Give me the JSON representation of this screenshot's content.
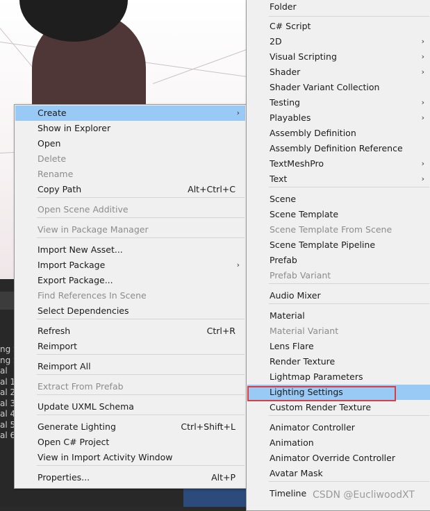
{
  "context_menu": {
    "items": [
      {
        "label": "Create",
        "submenu": true,
        "highlighted": true
      },
      {
        "label": "Show in Explorer"
      },
      {
        "label": "Open"
      },
      {
        "label": "Delete",
        "disabled": true
      },
      {
        "label": "Rename",
        "disabled": true
      },
      {
        "label": "Copy Path",
        "shortcut": "Alt+Ctrl+C"
      },
      {
        "label": "Open Scene Additive",
        "disabled": true
      },
      {
        "label": "View in Package Manager",
        "disabled": true
      },
      {
        "label": "Import New Asset..."
      },
      {
        "label": "Import Package",
        "submenu": true
      },
      {
        "label": "Export Package..."
      },
      {
        "label": "Find References In Scene",
        "disabled": true
      },
      {
        "label": "Select Dependencies"
      },
      {
        "label": "Refresh",
        "shortcut": "Ctrl+R"
      },
      {
        "label": "Reimport"
      },
      {
        "label": "Reimport All"
      },
      {
        "label": "Extract From Prefab",
        "disabled": true
      },
      {
        "label": "Update UXML Schema"
      },
      {
        "label": "Generate Lighting",
        "shortcut": "Ctrl+Shift+L"
      },
      {
        "label": "Open C# Project"
      },
      {
        "label": "View in Import Activity Window"
      },
      {
        "label": "Properties...",
        "shortcut": "Alt+P"
      }
    ]
  },
  "create_submenu": {
    "items": [
      {
        "label": "Folder"
      },
      {
        "label": "C# Script"
      },
      {
        "label": "2D",
        "submenu": true
      },
      {
        "label": "Visual Scripting",
        "submenu": true
      },
      {
        "label": "Shader",
        "submenu": true
      },
      {
        "label": "Shader Variant Collection"
      },
      {
        "label": "Testing",
        "submenu": true
      },
      {
        "label": "Playables",
        "submenu": true
      },
      {
        "label": "Assembly Definition"
      },
      {
        "label": "Assembly Definition Reference"
      },
      {
        "label": "TextMeshPro",
        "submenu": true
      },
      {
        "label": "Text",
        "submenu": true
      },
      {
        "label": "Scene"
      },
      {
        "label": "Scene Template"
      },
      {
        "label": "Scene Template From Scene",
        "disabled": true
      },
      {
        "label": "Scene Template Pipeline"
      },
      {
        "label": "Prefab"
      },
      {
        "label": "Prefab Variant",
        "disabled": true
      },
      {
        "label": "Audio Mixer"
      },
      {
        "label": "Material"
      },
      {
        "label": "Material Variant",
        "disabled": true
      },
      {
        "label": "Lens Flare"
      },
      {
        "label": "Render Texture"
      },
      {
        "label": "Lightmap Parameters"
      },
      {
        "label": "Lighting Settings",
        "highlighted": true
      },
      {
        "label": "Custom Render Texture"
      },
      {
        "label": "Animator Controller"
      },
      {
        "label": "Animation"
      },
      {
        "label": "Animator Override Controller"
      },
      {
        "label": "Avatar Mask"
      },
      {
        "label": "Timeline"
      }
    ]
  },
  "arrow_glyph": "›",
  "console_fragments": [
    "ng S",
    "ng S",
    "al",
    "al 1",
    "al 2",
    "al 3",
    "al 4",
    "al 5",
    "al 6"
  ],
  "watermark": "CSDN @EucliwoodXT",
  "colors": {
    "highlight": "#99c9f5",
    "red_box": "#e0393e"
  }
}
